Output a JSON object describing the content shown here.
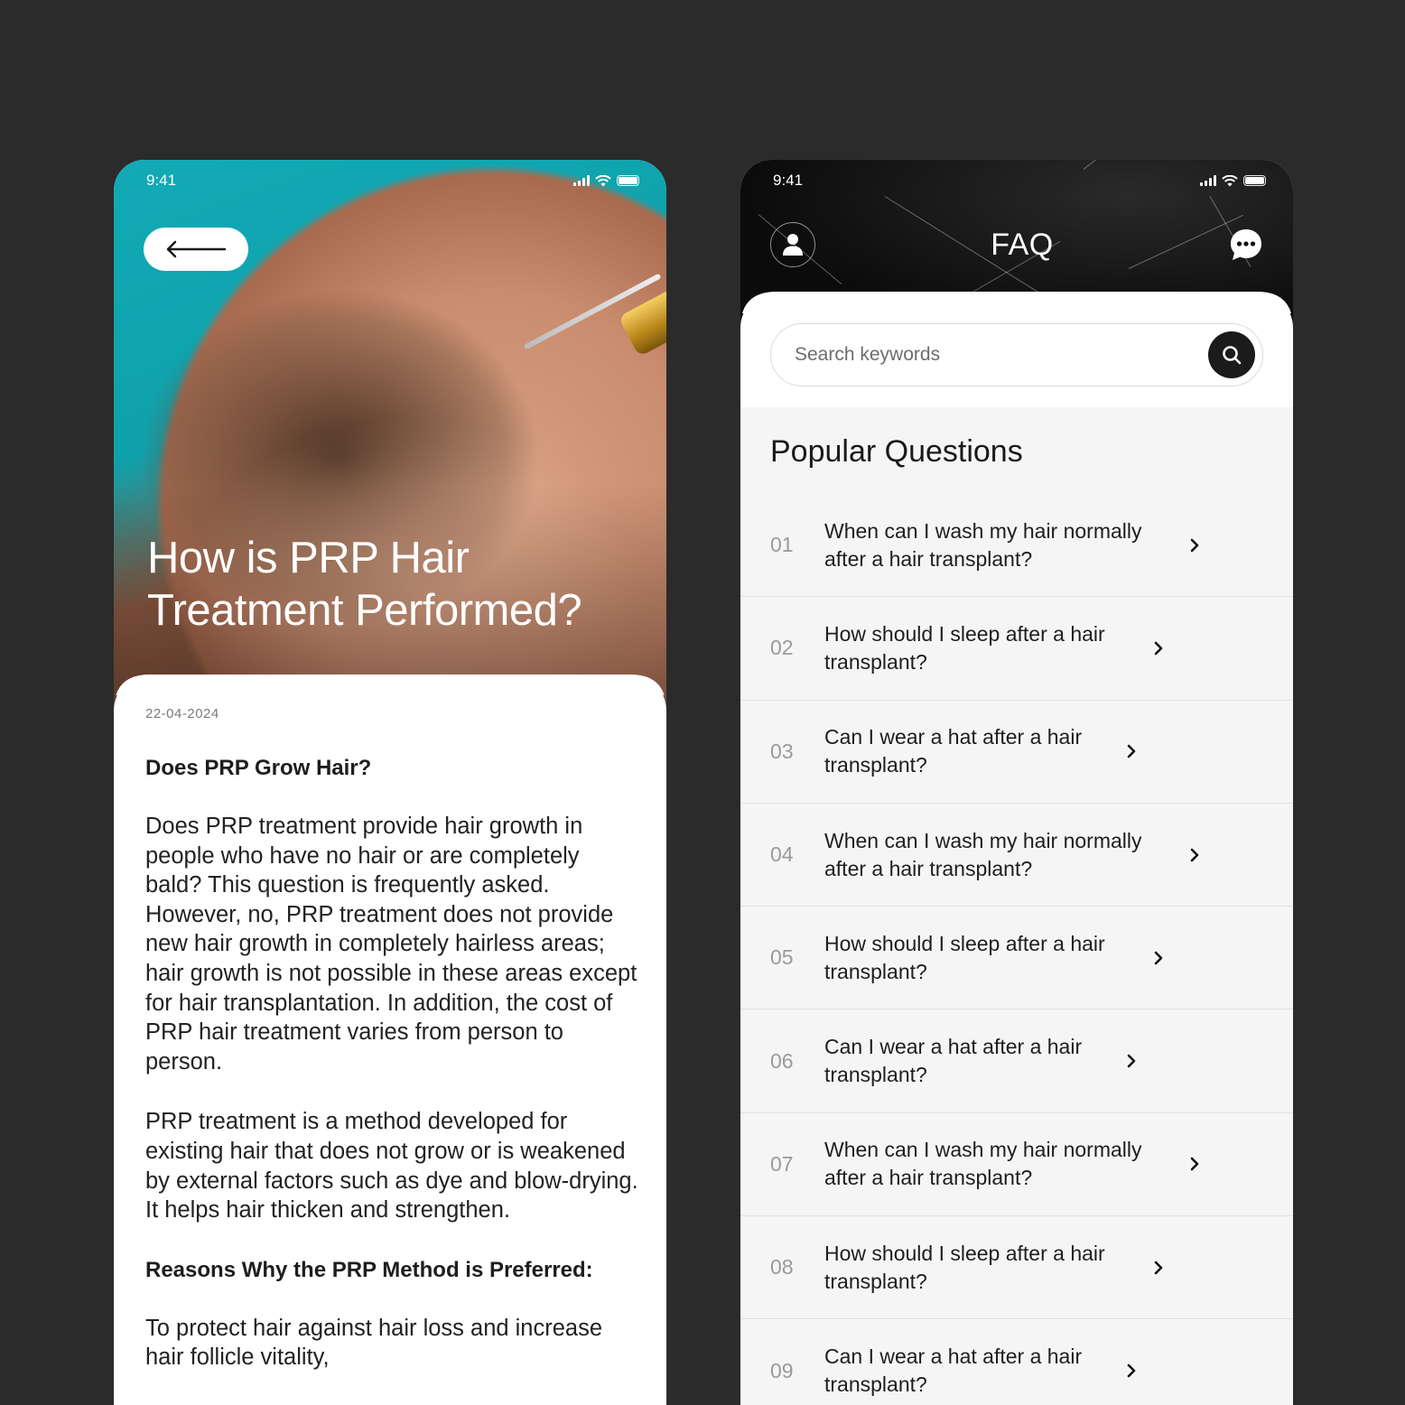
{
  "left_phone": {
    "status": {
      "time": "9:41"
    },
    "hero": {
      "title_line1": "How is PRP Hair",
      "title_line2": "Treatment Performed?"
    },
    "article": {
      "date": "22-04-2024",
      "heading1": "Does PRP Grow Hair?",
      "paragraph1": "Does PRP treatment provide hair growth in people who have no hair or are completely bald? This question is frequently asked. However, no, PRP treatment does not provide new hair growth in completely hairless areas; hair growth is not possible in these areas except for hair transplantation. In addition, the cost of PRP hair treatment varies from person to person.",
      "paragraph2": "PRP treatment is a method developed for existing hair that does not grow or is weakened by external factors such as dye and blow-drying. It helps hair thicken and strengthen.",
      "heading2": "Reasons Why the PRP Method is Preferred:",
      "paragraph3": "To protect hair against hair loss and increase hair follicle vitality,"
    }
  },
  "right_phone": {
    "status": {
      "time": "9:41"
    },
    "header": {
      "title": "FAQ"
    },
    "search": {
      "placeholder": "Search keywords",
      "value": ""
    },
    "section_title": "Popular Questions",
    "questions": [
      {
        "num": "01",
        "text": "When can I wash my hair normally after a hair transplant?"
      },
      {
        "num": "02",
        "text": "How should I sleep after a hair transplant?"
      },
      {
        "num": "03",
        "text": "Can I wear a hat after a hair transplant?"
      },
      {
        "num": "04",
        "text": "When can I wash my hair normally after a hair transplant?"
      },
      {
        "num": "05",
        "text": "How should I sleep after a hair transplant?"
      },
      {
        "num": "06",
        "text": "Can I wear a hat after a hair transplant?"
      },
      {
        "num": "07",
        "text": "When can I wash my hair normally after a hair transplant?"
      },
      {
        "num": "08",
        "text": "How should I sleep after a hair transplant?"
      },
      {
        "num": "09",
        "text": "Can I wear a hat after a hair transplant?"
      }
    ]
  },
  "icons": {
    "back": "arrow-left-icon",
    "user": "user-icon",
    "chat": "chat-bubble-icon",
    "search": "search-icon",
    "chevron": "chevron-right-icon"
  },
  "colors": {
    "background": "#2b2b2b",
    "hero_teal": "#12aab5",
    "dark": "#1b1b1b"
  }
}
